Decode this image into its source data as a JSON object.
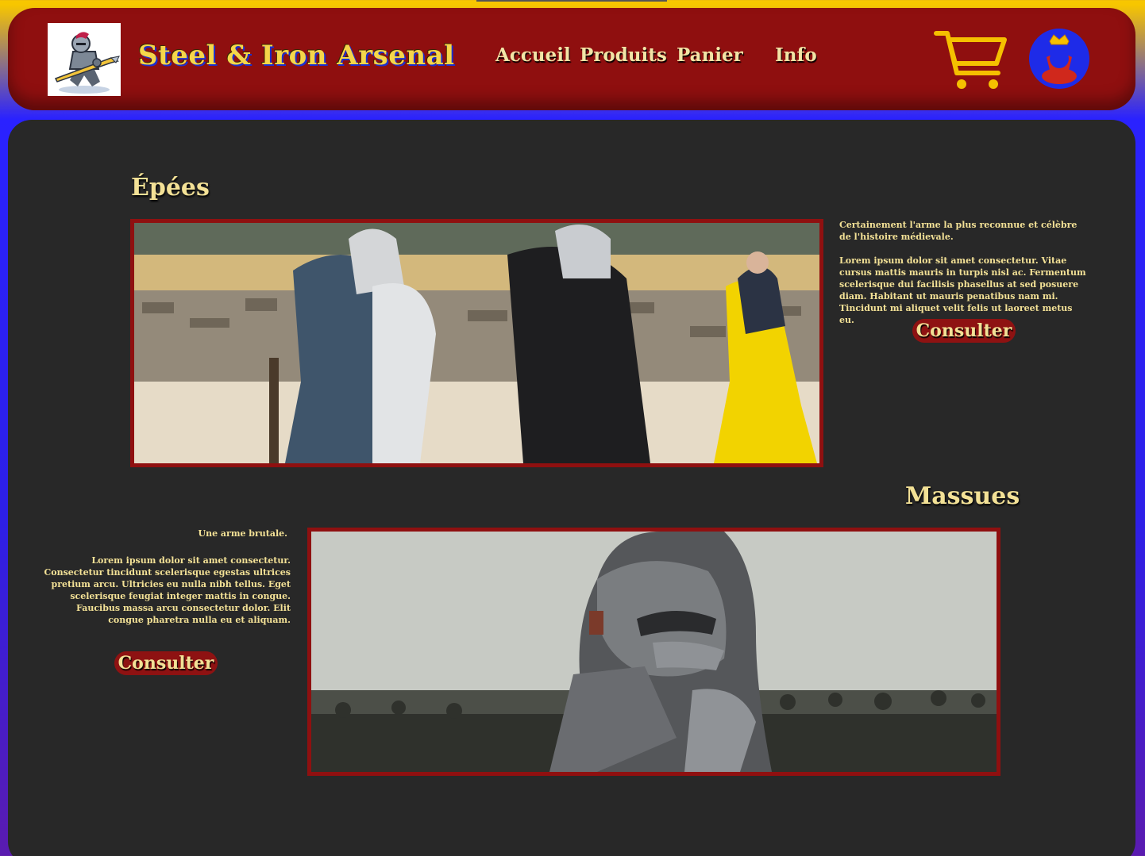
{
  "header": {
    "brand": "Steel & Iron Arsenal",
    "nav": [
      {
        "label": "Accueil"
      },
      {
        "label": "Produits"
      },
      {
        "label": "Panier"
      },
      {
        "label": "Info"
      }
    ],
    "icons": {
      "logo": "knight-logo-icon",
      "cart": "shopping-cart-icon",
      "account": "crowned-user-icon"
    }
  },
  "sections": [
    {
      "title": "Épées",
      "intro": "Certainement l'arme la plus reconnue et célèbre de l'histoire médievale.",
      "body": "Lorem ipsum dolor sit amet consectetur. Vitae cursus mattis mauris in turpis nisl ac. Fermentum scelerisque dui facilisis phasellus at sed posuere diam. Habitant ut mauris penatibus nam mi. Tincidunt mi aliquet velit felis ut laoreet metus eu.",
      "button": "Consulter"
    },
    {
      "title": "Massues",
      "intro": "Une arme brutale.",
      "body": "Lorem ipsum dolor sit amet consectetur. Consectetur tincidunt scelerisque egestas ultrices pretium arcu. Ultricies eu nulla nibh tellus. Eget scelerisque feugiat integer mattis in congue. Faucibus massa arcu consectetur dolor. Elit congue pharetra nulla eu et aliquam.",
      "button": "Consulter"
    }
  ],
  "colors": {
    "header_bg": "#8f0f0f",
    "content_bg": "#282828",
    "accent_gold": "#f3e196",
    "cart_gold": "#f5c000",
    "avatar_blue": "#1e2be8",
    "page_gradient_top": "#f7c600",
    "page_gradient_bottom": "#2a22ff"
  }
}
